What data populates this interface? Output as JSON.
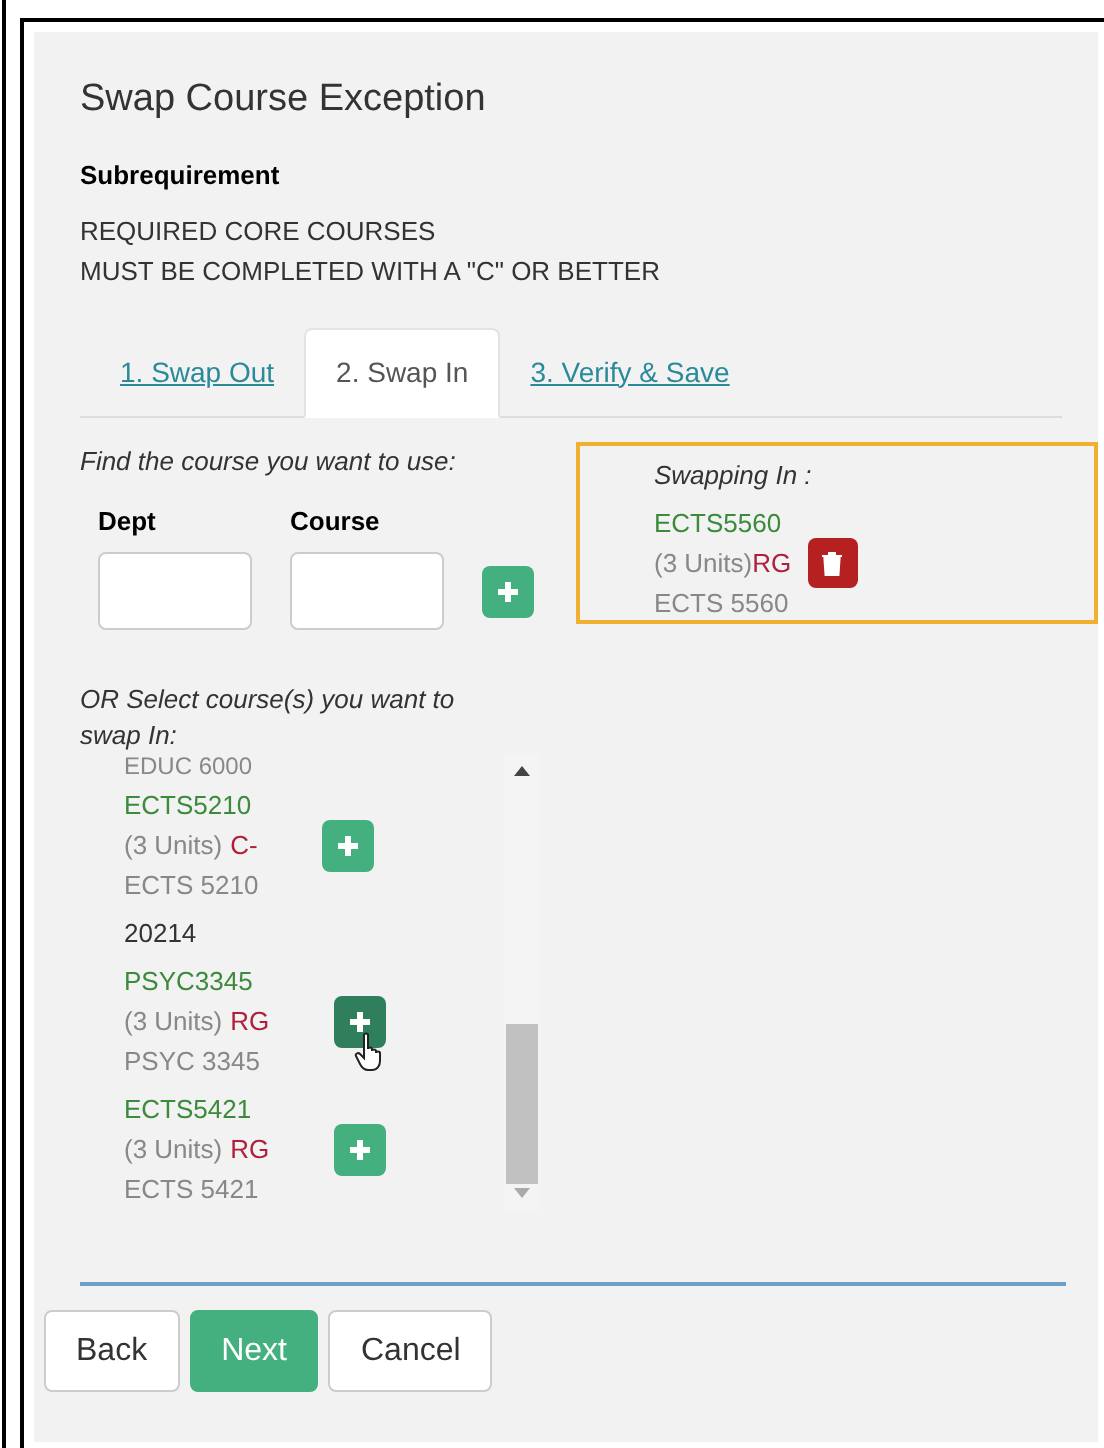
{
  "dialog": {
    "title": "Swap Course Exception",
    "subheading": "Subrequirement",
    "description_lines": [
      "REQUIRED CORE COURSES",
      "MUST BE COMPLETED WITH A \"C\" OR BETTER"
    ]
  },
  "tabs": [
    {
      "label": "1. Swap Out",
      "selected": false
    },
    {
      "label": "2. Swap In",
      "selected": true
    },
    {
      "label": "3. Verify & Save",
      "selected": false
    }
  ],
  "find": {
    "prompt": "Find the course you want to use:",
    "fields": [
      {
        "label": "Dept"
      },
      {
        "label": "Course"
      }
    ]
  },
  "swapping_in": {
    "title": "Swapping In :",
    "course": {
      "code": "ECTS5560",
      "units": "(3 Units)",
      "grade": "RG",
      "name": "ECTS 5560"
    }
  },
  "select": {
    "prompt": "OR Select course(s) you want to swap In:",
    "partial_item": "EDUC 6000",
    "items": [
      {
        "kind": "course",
        "code": "ECTS5210",
        "units": "(3 Units)",
        "grade": "C-",
        "name": "ECTS 5210",
        "hovered": false
      },
      {
        "kind": "term",
        "label": "20214"
      },
      {
        "kind": "course",
        "code": "PSYC3345",
        "units": "(3 Units)",
        "grade": "RG",
        "name": "PSYC 3345",
        "hovered": true
      },
      {
        "kind": "course",
        "code": "ECTS5421",
        "units": "(3 Units)",
        "grade": "RG",
        "name": "ECTS 5421",
        "hovered": false
      }
    ]
  },
  "buttons": [
    {
      "label": "Back",
      "kind": "default"
    },
    {
      "label": "Next",
      "kind": "primary"
    },
    {
      "label": "Cancel",
      "kind": "default"
    }
  ]
}
